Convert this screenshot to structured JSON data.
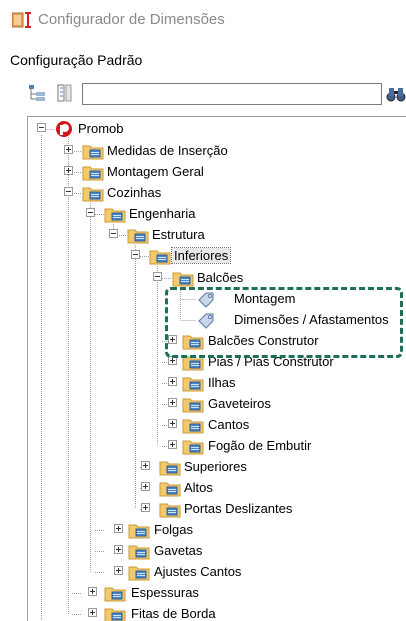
{
  "window": {
    "title": "Configurador de Dimensões",
    "icon": "configurator-icon"
  },
  "panel": {
    "label": "Configuração Padrão"
  },
  "toolbar": {
    "collapse_all_icon": "collapse-tree-icon",
    "expand_all_icon": "expand-tree-icon",
    "search_value": "",
    "search_placeholder": "",
    "find_icon": "binoculars-icon"
  },
  "tree": {
    "root": "Promob",
    "medidas": "Medidas de Inserção",
    "montagem_geral": "Montagem Geral",
    "cozinhas": "Cozinhas",
    "engenharia": "Engenharia",
    "estrutura": "Estrutura",
    "inferiores": "Inferiores",
    "balcoes": "Balcões",
    "montagem": "Montagem",
    "dimensoes": "Dimensões / Afastamentos",
    "balcoes_construtor": "Balcões Construtor",
    "pias": "Pias / Pias Construtor",
    "ilhas": "Ilhas",
    "gaveteiros": "Gaveteiros",
    "cantos": "Cantos",
    "fogao": "Fogão de Embutir",
    "superiores": "Superiores",
    "altos": "Altos",
    "portas": "Portas Deslizantes",
    "folgas": "Folgas",
    "gavetas": "Gavetas",
    "ajustes": "Ajustes Cantos",
    "espessuras": "Espessuras",
    "fitas": "Fitas de Borda"
  },
  "colors": {
    "highlight": "#1d6f5b",
    "folder": "#f3c96b",
    "root_icon": "#d0171a"
  }
}
